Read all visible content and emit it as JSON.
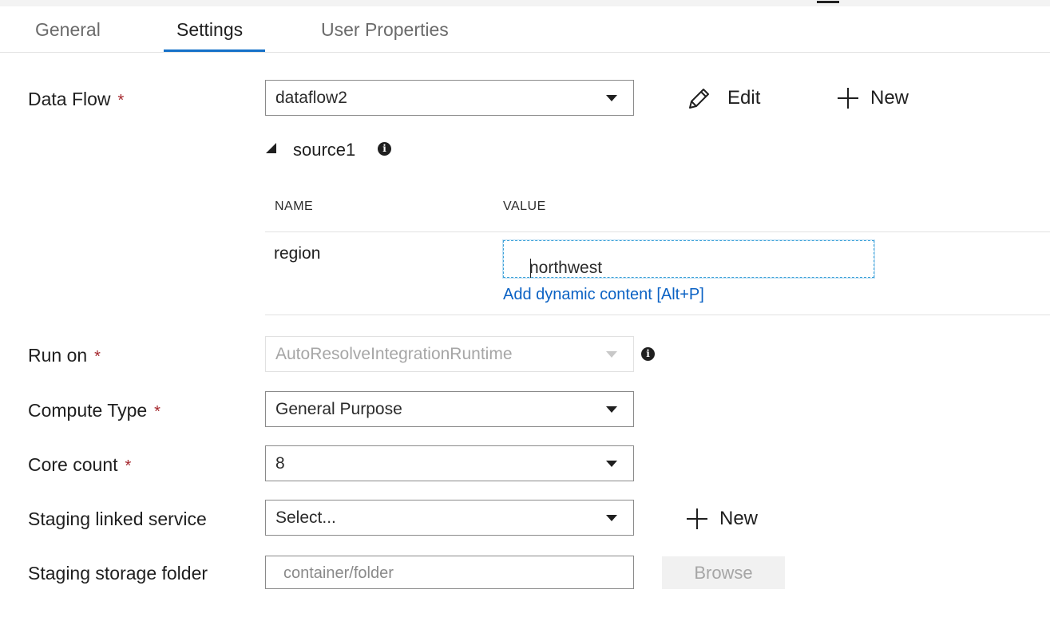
{
  "tabs": [
    {
      "label": "General",
      "active": false
    },
    {
      "label": "Settings",
      "active": true
    },
    {
      "label": "User Properties",
      "active": false
    }
  ],
  "data_flow": {
    "label": "Data Flow",
    "required_mark": "*",
    "selected": "dataflow2",
    "edit_label": "Edit",
    "new_label": "New"
  },
  "source": {
    "name": "source1",
    "table": {
      "headers": {
        "name": "NAME",
        "value": "VALUE"
      },
      "rows": [
        {
          "name": "region",
          "value": "northwest",
          "dynamic_link": "Add dynamic content [Alt+P]"
        }
      ]
    }
  },
  "run_on": {
    "label": "Run on",
    "required_mark": "*",
    "selected": "AutoResolveIntegrationRuntime",
    "disabled": true
  },
  "compute_type": {
    "label": "Compute Type",
    "required_mark": "*",
    "selected": "General Purpose"
  },
  "core_count": {
    "label": "Core count",
    "required_mark": "*",
    "selected": "8"
  },
  "staging_linked_service": {
    "label": "Staging linked service",
    "selected": "Select...",
    "new_label": "New"
  },
  "staging_storage_folder": {
    "label": "Staging storage folder",
    "placeholder": "container/folder",
    "browse_label": "Browse"
  },
  "icons": [
    "pencil-icon",
    "plus-icon",
    "info-icon",
    "chevron-down-icon",
    "collapse-triangle-icon"
  ],
  "colors": {
    "accent": "#1470c8",
    "link": "#0b62c4",
    "required": "#a4262c",
    "focus_border": "#3aa0d8"
  }
}
